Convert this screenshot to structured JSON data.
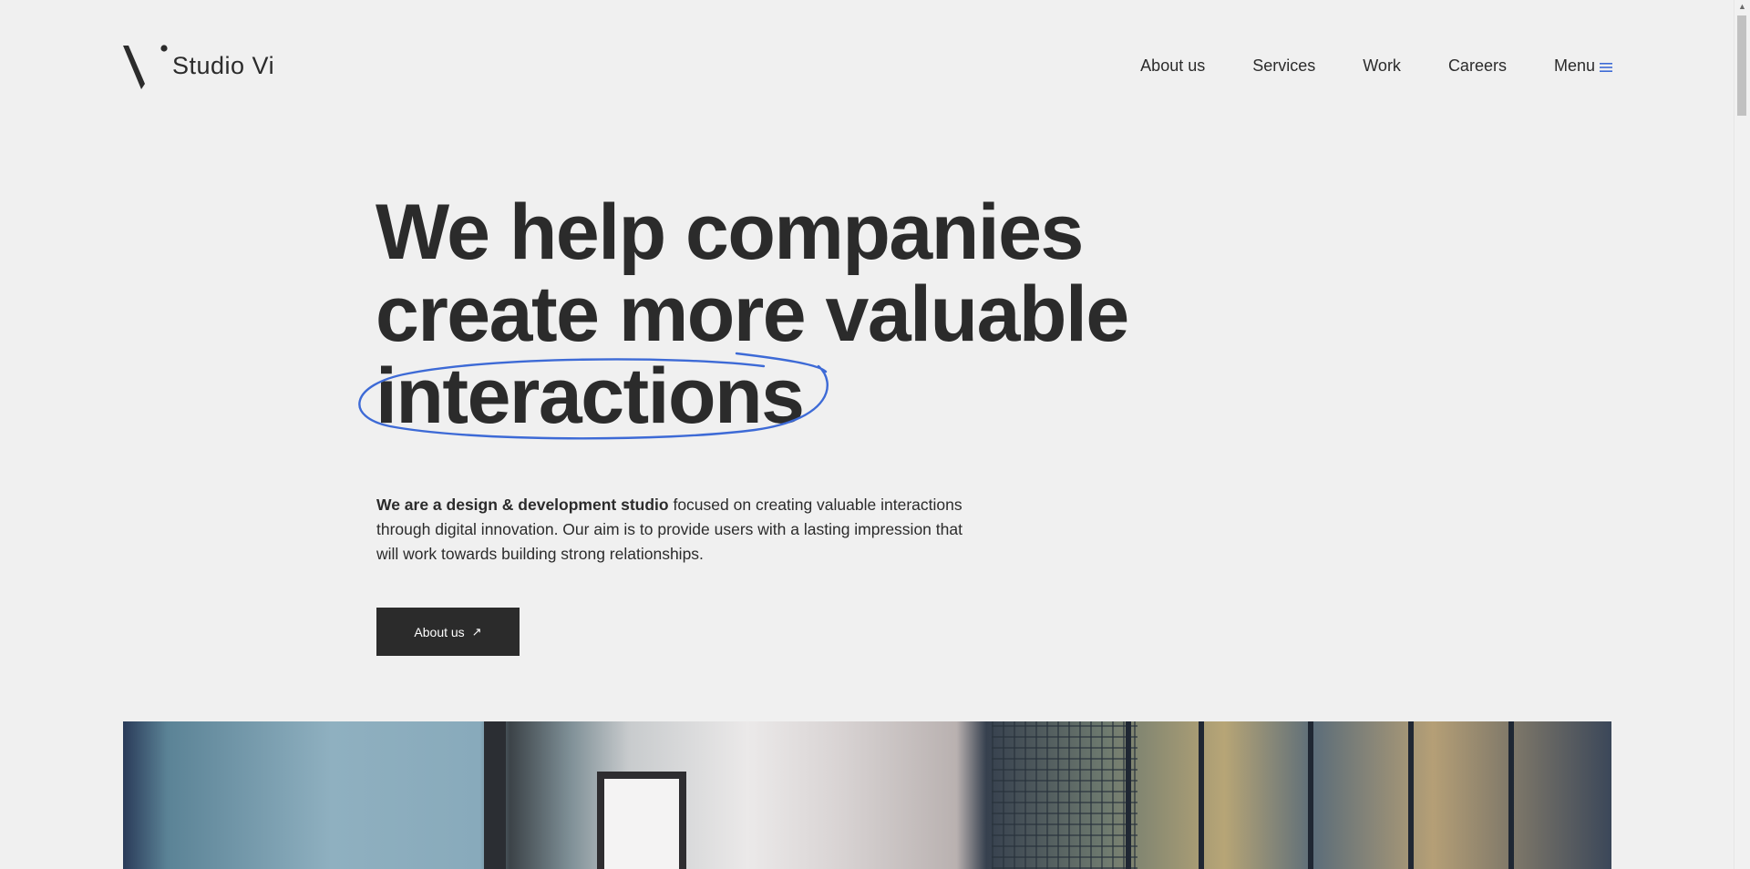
{
  "brand": {
    "name": "Studio Vi",
    "logo_icon": "studio-vi-logo-icon"
  },
  "nav": {
    "items": [
      {
        "label": "About us"
      },
      {
        "label": "Services"
      },
      {
        "label": "Work"
      },
      {
        "label": "Careers"
      }
    ],
    "menu_label": "Menu",
    "menu_icon": "hamburger-icon"
  },
  "hero": {
    "line1": "We help companies",
    "line2": "create more valuable",
    "highlight": "interactions",
    "intro_bold": "We are a design & development studio",
    "intro_rest": " focused on creating valuable interactions through digital innovation. Our aim is to provide users with a lasting impression that will work towards building strong relationships.",
    "cta_label": "About us",
    "cta_icon": "arrow-up-right-icon"
  },
  "colors": {
    "text": "#2b2b2b",
    "accent": "#3d6ad6",
    "background": "#f0f0f0",
    "button": "#2b2b2b"
  }
}
